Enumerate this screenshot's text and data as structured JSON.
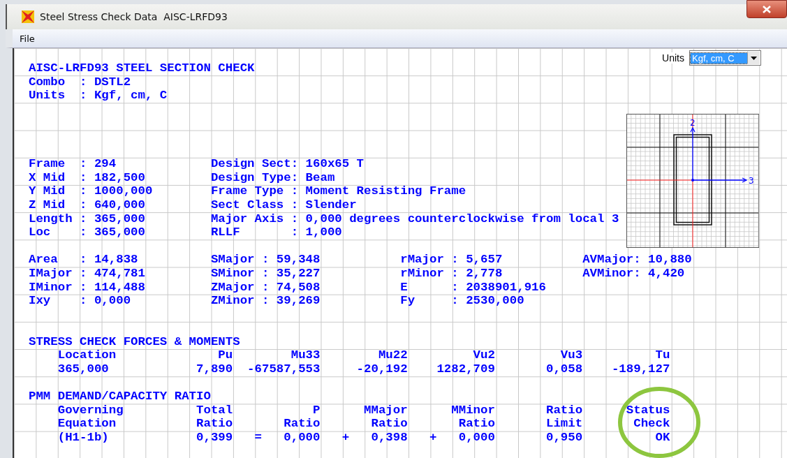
{
  "window": {
    "title": "Steel Stress Check Data  AISC-LRFD93"
  },
  "menu": [
    "File"
  ],
  "units_selector": {
    "label": "Units",
    "value": "Kgf, cm, C"
  },
  "section_drawing": {
    "axis_labels": [
      "2",
      "3"
    ]
  },
  "report": {
    "header": {
      "title": "AISC-LRFD93 STEEL SECTION CHECK",
      "lines": [
        "Combo  : DSTL2",
        "Units  : Kgf, cm, C"
      ]
    },
    "frame_info": {
      "lines": [
        "Frame  : 294             Design Sect: 160x65 T",
        "X Mid  : 182,500         Design Type: Beam",
        "Y Mid  : 1000,000        Frame Type : Moment Resisting Frame",
        "Z Mid  : 640,000         Sect Class : Slender",
        "Length : 365,000         Major Axis : 0,000 degrees counterclockwise from local 3",
        "Loc    : 365,000         RLLF       : 1,000"
      ]
    },
    "properties": {
      "lines": [
        "Area   : 14,838          SMajor : 59,348           rMajor : 5,657           AVMajor: 10,880",
        "IMajor : 474,781         SMinor : 35,227           rMinor : 2,778           AVMinor: 4,420",
        "IMinor : 114,488         ZMajor : 74,508           E      : 2038901,916",
        "Ixy    : 0,000           ZMinor : 39,269           Fy     : 2530,000"
      ]
    },
    "forces": {
      "title": "STRESS CHECK FORCES & MOMENTS",
      "lines": [
        "    Location              Pu        Mu33        Mu22         Vu2         Vu3          Tu",
        "    365,000            7,890  -67587,553     -20,192    1282,709       0,058    -189,127"
      ]
    },
    "pmm": {
      "title": "PMM DEMAND/CAPACITY RATIO",
      "lines": [
        "    Governing          Total           P      MMajor      MMinor       Ratio      Status",
        "    Equation           Ratio       Ratio       Ratio       Ratio       Limit       Check",
        "    (H1-1b)            0,399   =   0,000   +   0,398   +   0,000       0,950          OK"
      ]
    }
  }
}
